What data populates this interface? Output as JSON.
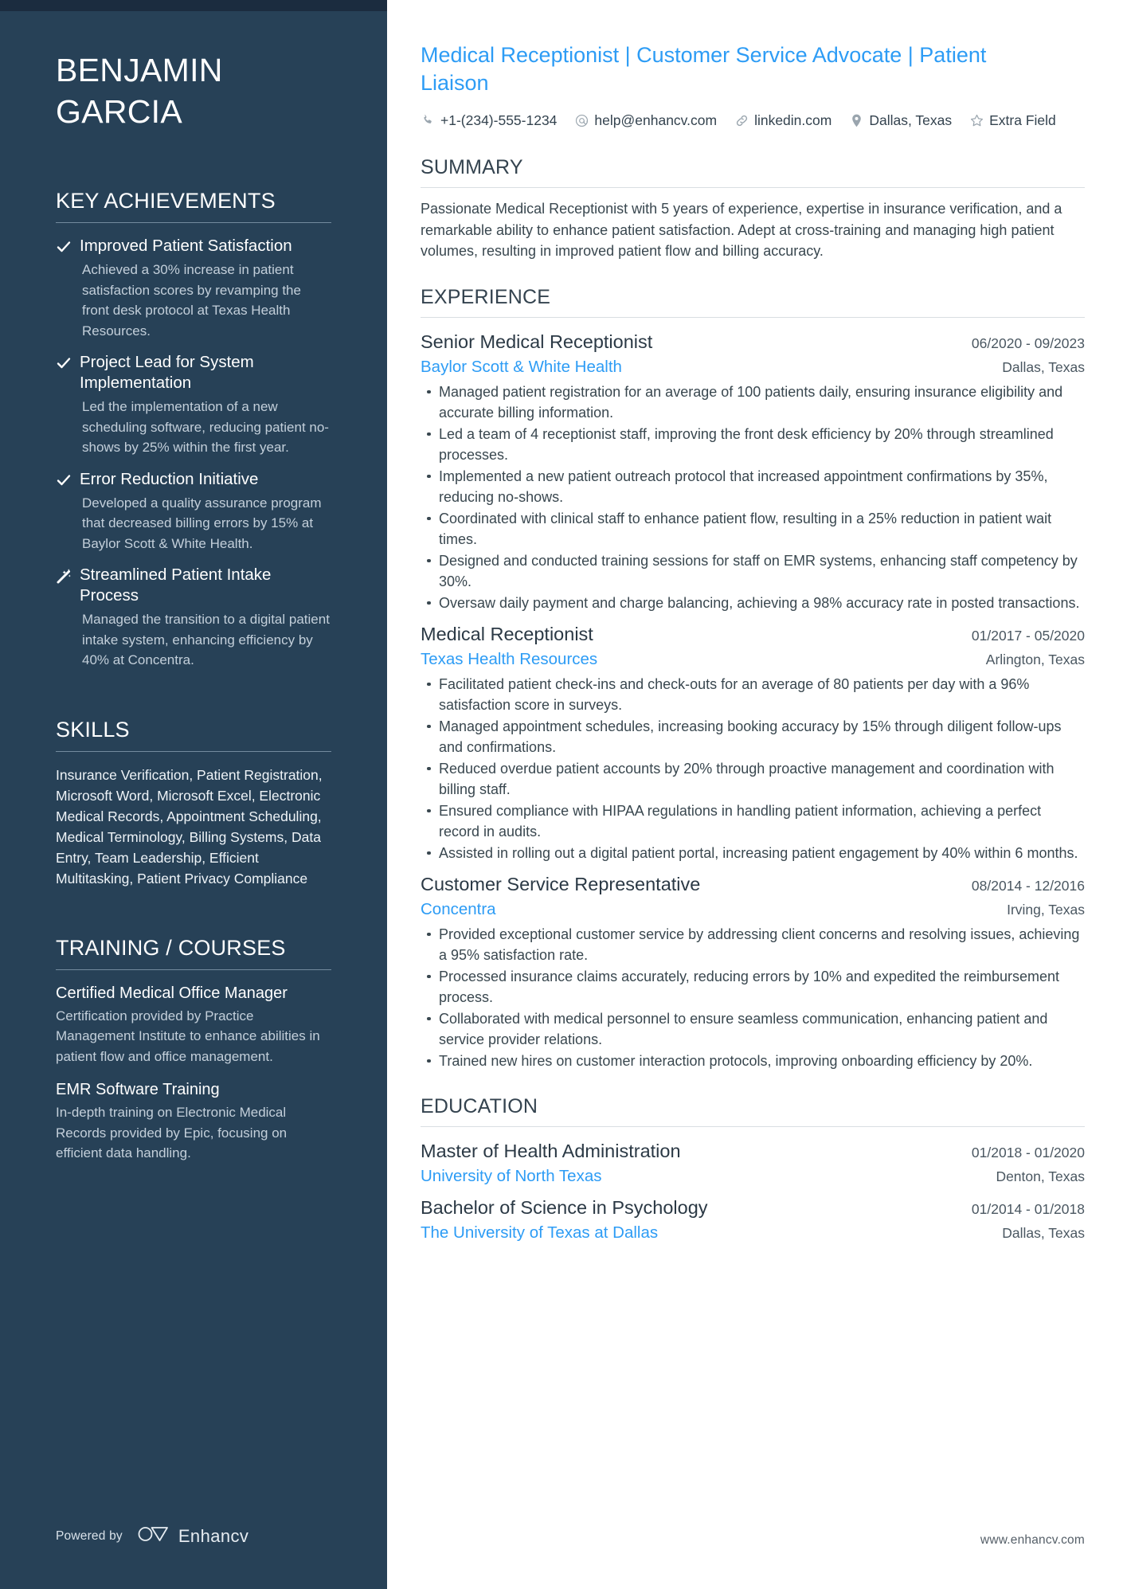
{
  "colors": {
    "sidebar_bg": "#274157",
    "topbar_bg": "#1b2c3f",
    "accent_blue": "#2d9cf5",
    "body_text": "#39474f",
    "muted_sidebar_text": "#c3cfda"
  },
  "sidebar": {
    "name": {
      "first": "BENJAMIN",
      "last": "GARCIA"
    },
    "achievements_section": {
      "heading": "KEY ACHIEVEMENTS",
      "items": [
        {
          "icon": "check-icon",
          "title": "Improved Patient Satisfaction",
          "description": "Achieved a 30% increase in patient satisfaction scores by revamping the front desk protocol at Texas Health Resources."
        },
        {
          "icon": "check-icon",
          "title": "Project Lead for System Implementation",
          "description": "Led the implementation of a new scheduling software, reducing patient no-shows by 25% within the first year."
        },
        {
          "icon": "check-icon",
          "title": "Error Reduction Initiative",
          "description": "Developed a quality assurance program that decreased billing errors by 15% at Baylor Scott & White Health."
        },
        {
          "icon": "magic-wand-icon",
          "title": "Streamlined Patient Intake Process",
          "description": "Managed the transition to a digital patient intake system, enhancing efficiency by 40% at Concentra."
        }
      ]
    },
    "skills_section": {
      "heading": "SKILLS",
      "text": "Insurance Verification, Patient Registration, Microsoft Word, Microsoft Excel, Electronic Medical Records, Appointment Scheduling, Medical Terminology, Billing Systems, Data Entry, Team Leadership, Efficient Multitasking, Patient Privacy Compliance"
    },
    "training_section": {
      "heading": "TRAINING / COURSES",
      "items": [
        {
          "title": "Certified Medical Office Manager",
          "description": "Certification provided by Practice Management Institute to enhance abilities in patient flow and office management."
        },
        {
          "title": "EMR Software Training",
          "description": "In-depth training on Electronic Medical Records provided by Epic, focusing on efficient data handling."
        }
      ]
    },
    "footer": {
      "powered_by": "Powered by",
      "brand": "Enhancv"
    }
  },
  "main": {
    "headline": "Medical Receptionist | Customer Service Advocate | Patient Liaison",
    "contacts": [
      {
        "icon": "phone-icon",
        "value": "+1-(234)-555-1234"
      },
      {
        "icon": "at-email-icon",
        "value": "help@enhancv.com"
      },
      {
        "icon": "link-icon",
        "value": "linkedin.com"
      },
      {
        "icon": "location-pin-icon",
        "value": "Dallas, Texas"
      },
      {
        "icon": "star-icon",
        "value": "Extra Field"
      }
    ],
    "summary": {
      "heading": "SUMMARY",
      "text": "Passionate Medical Receptionist with 5 years of experience, expertise in insurance verification, and a remarkable ability to enhance patient satisfaction. Adept at cross-training and managing high patient volumes, resulting in improved patient flow and billing accuracy."
    },
    "experience": {
      "heading": "EXPERIENCE",
      "entries": [
        {
          "title": "Senior Medical Receptionist",
          "date": "06/2020 - 09/2023",
          "organization": "Baylor Scott & White Health",
          "location": "Dallas, Texas",
          "bullets": [
            "Managed patient registration for an average of 100 patients daily, ensuring insurance eligibility and accurate billing information.",
            "Led a team of 4 receptionist staff, improving the front desk efficiency by 20% through streamlined processes.",
            "Implemented a new patient outreach protocol that increased appointment confirmations by 35%, reducing no-shows.",
            "Coordinated with clinical staff to enhance patient flow, resulting in a 25% reduction in patient wait times.",
            "Designed and conducted training sessions for staff on EMR systems, enhancing staff competency by 30%.",
            "Oversaw daily payment and charge balancing, achieving a 98% accuracy rate in posted transactions."
          ]
        },
        {
          "title": "Medical Receptionist",
          "date": "01/2017 - 05/2020",
          "organization": "Texas Health Resources",
          "location": "Arlington, Texas",
          "bullets": [
            "Facilitated patient check-ins and check-outs for an average of 80 patients per day with a 96% satisfaction score in surveys.",
            "Managed appointment schedules, increasing booking accuracy by 15% through diligent follow-ups and confirmations.",
            "Reduced overdue patient accounts by 20% through proactive management and coordination with billing staff.",
            "Ensured compliance with HIPAA regulations in handling patient information, achieving a perfect record in audits.",
            "Assisted in rolling out a digital patient portal, increasing patient engagement by 40% within 6 months."
          ]
        },
        {
          "title": "Customer Service Representative",
          "date": "08/2014 - 12/2016",
          "organization": "Concentra",
          "location": "Irving, Texas",
          "bullets": [
            "Provided exceptional customer service by addressing client concerns and resolving issues, achieving a 95% satisfaction rate.",
            "Processed insurance claims accurately, reducing errors by 10% and expedited the reimbursement process.",
            "Collaborated with medical personnel to ensure seamless communication, enhancing patient and service provider relations.",
            "Trained new hires on customer interaction protocols, improving onboarding efficiency by 20%."
          ]
        }
      ]
    },
    "education": {
      "heading": "EDUCATION",
      "entries": [
        {
          "title": "Master of Health Administration",
          "date": "01/2018 - 01/2020",
          "organization": "University of North Texas",
          "location": "Denton, Texas"
        },
        {
          "title": "Bachelor of Science in Psychology",
          "date": "01/2014 - 01/2018",
          "organization": "The University of Texas at Dallas",
          "location": "Dallas, Texas"
        }
      ]
    },
    "footer": {
      "website": "www.enhancv.com"
    }
  }
}
